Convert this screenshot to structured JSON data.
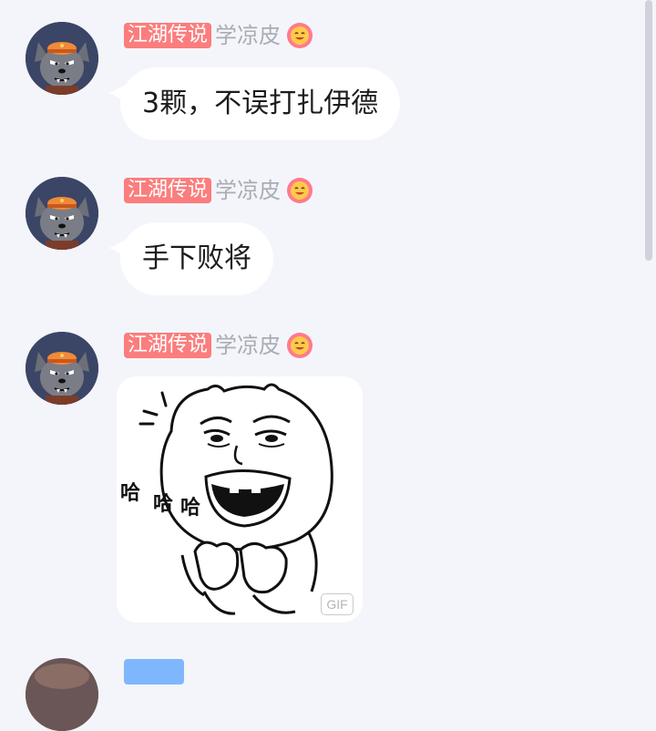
{
  "messages": [
    {
      "badge": "江湖传说",
      "nickname": "学凉皮",
      "text": "3颗，不误打扎伊德",
      "avatar_icon": "wolf-avatar-icon",
      "status_icon": "smile-face-icon"
    },
    {
      "badge": "江湖传说",
      "nickname": "学凉皮",
      "text": "手下败将",
      "avatar_icon": "wolf-avatar-icon",
      "status_icon": "smile-face-icon"
    },
    {
      "badge": "江湖传说",
      "nickname": "学凉皮",
      "sticker": {
        "caption_1": "哈",
        "caption_2": "哈",
        "caption_3": "哈",
        "format_label": "GIF"
      },
      "avatar_icon": "wolf-avatar-icon",
      "status_icon": "smile-face-icon"
    },
    {
      "badge": "",
      "nickname": "",
      "avatar_icon": "avatar-partial"
    }
  ],
  "colors": {
    "background": "#f4f5fa",
    "badge_red": "#fb7d7d",
    "badge_blue": "#7fb7ff",
    "nickname_gray": "#a9acb6",
    "bubble": "#ffffff"
  }
}
